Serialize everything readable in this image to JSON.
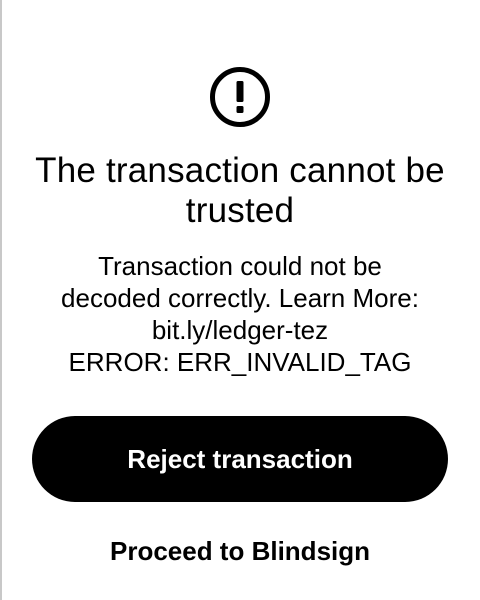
{
  "screen": {
    "title": "The transaction cannot be trusted",
    "message_lines": [
      "Transaction could not be",
      "decoded correctly. Learn More:",
      "bit.ly/ledger-tez",
      "ERROR: ERR_INVALID_TAG"
    ],
    "icon": "exclamation-circle-icon"
  },
  "actions": {
    "reject_label": "Reject transaction",
    "proceed_label": "Proceed to Blindsign"
  },
  "colors": {
    "background": "#ffffff",
    "foreground": "#000000",
    "button_text": "#ffffff"
  }
}
